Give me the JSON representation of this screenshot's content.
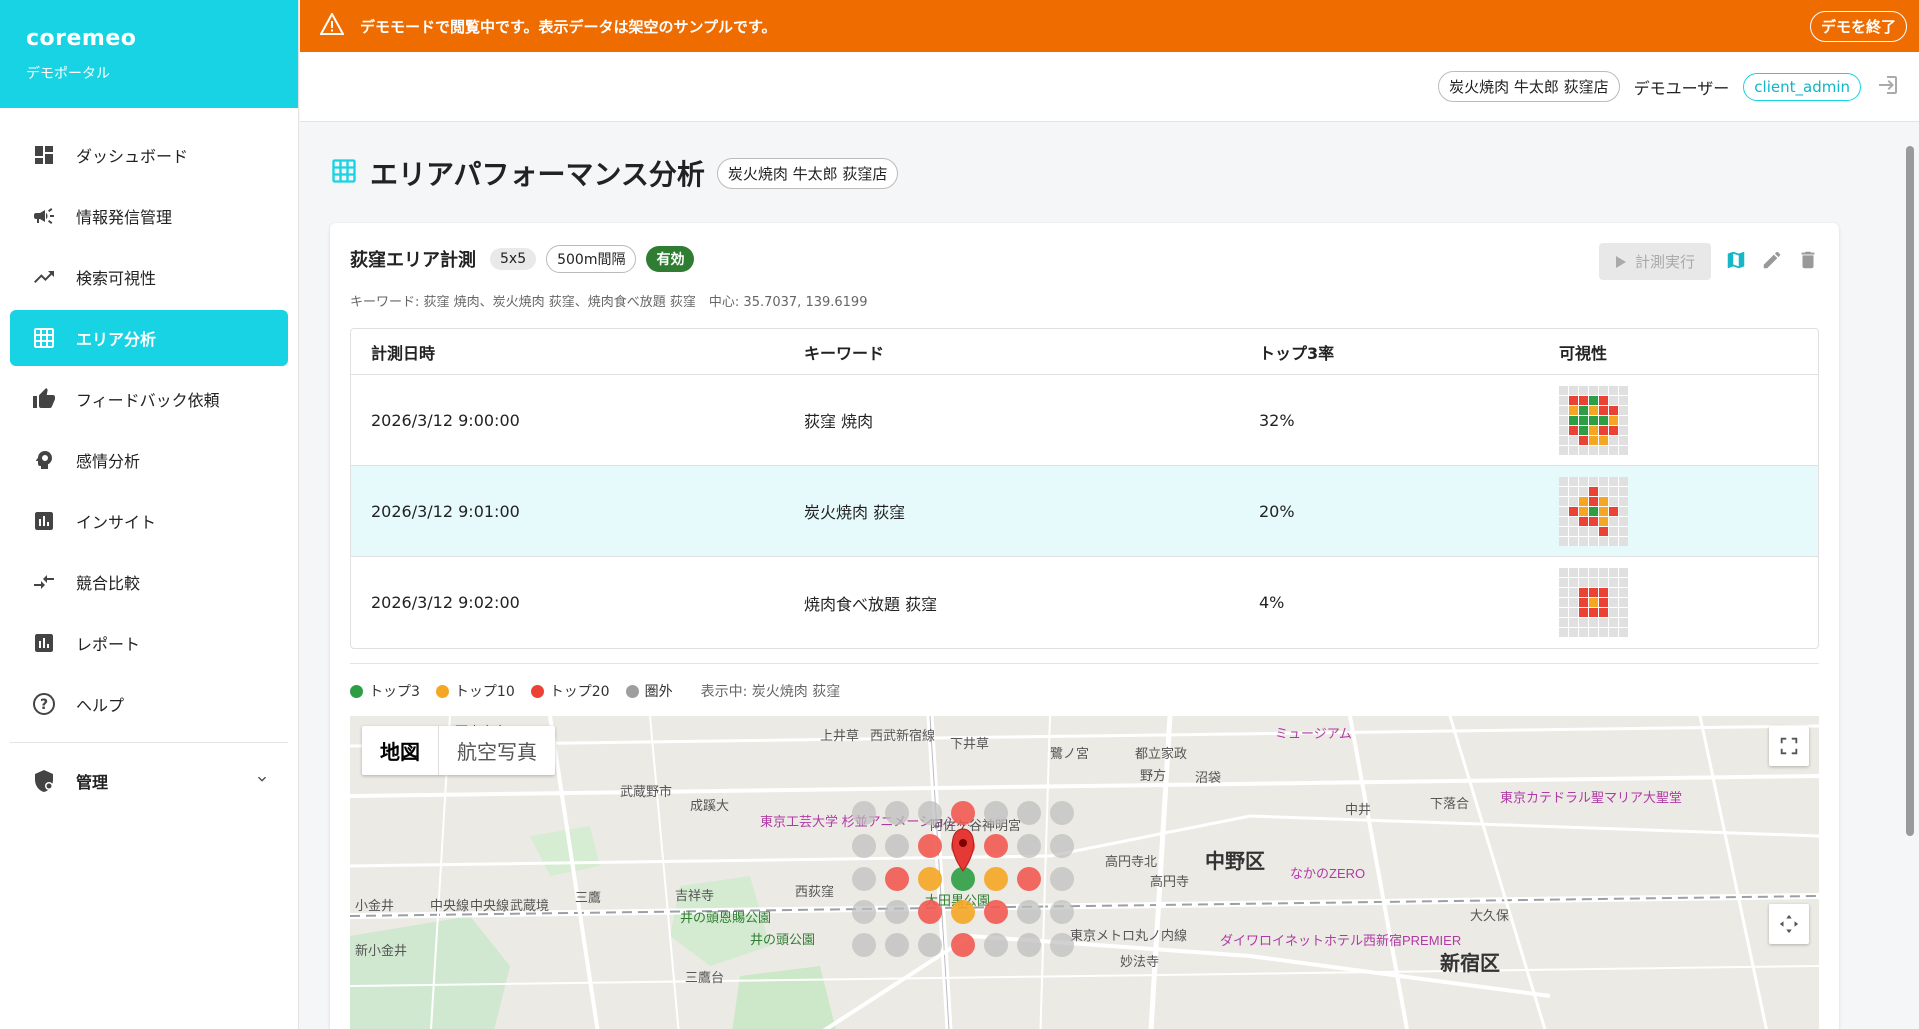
{
  "brand": {
    "name": "coremeo",
    "subtitle": "デモポータル"
  },
  "banner": {
    "message": "デモモードで閲覧中です。表示データは架空のサンプルです。",
    "end_button": "デモを終了"
  },
  "header": {
    "store": "炭火焼肉 牛太郎 荻窪店",
    "user": "デモユーザー",
    "role": "client_admin"
  },
  "sidebar": {
    "items": [
      {
        "label": "ダッシュボード",
        "icon": "dashboard-icon"
      },
      {
        "label": "情報発信管理",
        "icon": "megaphone-icon"
      },
      {
        "label": "検索可視性",
        "icon": "trending-icon"
      },
      {
        "label": "エリア分析",
        "icon": "grid-icon"
      },
      {
        "label": "フィードバック依頼",
        "icon": "thumbs-up-icon"
      },
      {
        "label": "感情分析",
        "icon": "emotion-icon"
      },
      {
        "label": "インサイト",
        "icon": "insights-icon"
      },
      {
        "label": "競合比較",
        "icon": "compare-icon"
      },
      {
        "label": "レポート",
        "icon": "report-icon"
      },
      {
        "label": "ヘルプ",
        "icon": "help-icon"
      }
    ],
    "admin": {
      "label": "管理",
      "icon": "admin-icon"
    }
  },
  "page": {
    "title": "エリアパフォーマンス分析",
    "store_chip": "炭火焼肉 牛太郎 荻窪店"
  },
  "measurement": {
    "name": "荻窪エリア計測",
    "grid": "5x5",
    "interval": "500m間隔",
    "status": "有効",
    "run_button": "計測実行",
    "meta": "キーワード: 荻窪 焼肉、炭火焼肉 荻窪、焼肉食べ放題 荻窪　中心: 35.7037, 139.6199"
  },
  "table": {
    "headers": [
      "計測日時",
      "キーワード",
      "トップ3率",
      "可視性"
    ],
    "rows": [
      {
        "datetime": "2026/3/12 9:00:00",
        "keyword": "荻窪 焼肉",
        "top3": "32%",
        "grid": "________RRGR___OGORR__GGGGO__RGORR___ROO________"
      },
      {
        "datetime": "2026/3/12 9:01:00",
        "keyword": "炭火焼肉 荻窪",
        "top3": "20%",
        "grid": "__________R_____ORO___ROGOR___RRO______R_________"
      },
      {
        "datetime": "2026/3/12 9:02:00",
        "keyword": "焼肉食べ放題 荻窪",
        "top3": "4%",
        "grid": "________________RRR____ROR____RRR________________"
      }
    ]
  },
  "legend": {
    "items": [
      {
        "label": "トップ3",
        "color": "#2e9e44"
      },
      {
        "label": "トップ10",
        "color": "#f5a623"
      },
      {
        "label": "トップ20",
        "color": "#ea4335"
      },
      {
        "label": "圏外",
        "color": "#9e9e9e"
      }
    ],
    "showing": "表示中: 炭火焼肉 荻窪"
  },
  "colors": {
    "accent": "#17d3e3",
    "banner": "#ef6c00",
    "green": "#2e9e44",
    "orange": "#f5a623",
    "red": "#ea4335",
    "grey": "#bdbdbd"
  },
  "map": {
    "types": [
      "地図",
      "航空写真"
    ],
    "labels": [
      "西東京市",
      "上井草",
      "西武新宿線",
      "下井草",
      "鷺ノ宮",
      "都立家政",
      "野方",
      "沼袋",
      "中井",
      "下落合",
      "東京カテドラル聖マリア大聖堂",
      "ミュージアム",
      "武蔵野市",
      "成蹊大",
      "東京工芸大学 杉並アニメーション…",
      "阿佐ケ谷神明宮",
      "高円寺北",
      "中野区",
      "なかのZERO",
      "中央線",
      "高円寺",
      "西荻窪",
      "吉祥寺",
      "武蔵境",
      "三鷹",
      "大田黒公園",
      "井の頭恩賜公園",
      "井の頭公園",
      "東京メトロ丸ノ内線",
      "ダイワロイネットホテル西新宿PREMIER",
      "新宿区",
      "大久保",
      "中央線",
      "妙法寺",
      "三鷹台",
      "小金井",
      "新小金井"
    ],
    "heat": {
      "rows": [
        [
          "X",
          "X",
          "R",
          "X",
          "X"
        ],
        [
          "X",
          "R",
          "R",
          "R",
          "X"
        ],
        [
          "R",
          "O",
          "G",
          "O",
          "R"
        ],
        [
          "X",
          "R",
          "O",
          "R",
          "X"
        ],
        [
          "X",
          "X",
          "R",
          "X",
          "X"
        ]
      ]
    }
  }
}
